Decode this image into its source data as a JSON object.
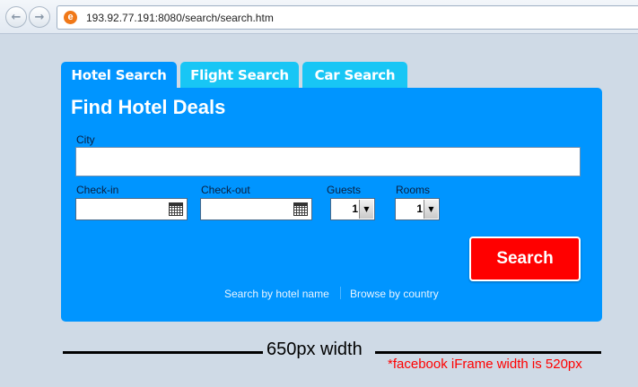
{
  "browser": {
    "url": "193.92.77.191:8080/search/search.htm",
    "site_icon": "e",
    "back_icon": "←",
    "forward_icon": "→"
  },
  "tabs": [
    {
      "label": "Hotel Search",
      "active": true
    },
    {
      "label": "Flight Search",
      "active": false
    },
    {
      "label": "Car Search",
      "active": false
    }
  ],
  "form": {
    "title": "Find Hotel Deals",
    "city_label": "City",
    "city_value": "",
    "checkin_label": "Check-in",
    "checkin_value": "",
    "checkout_label": "Check-out",
    "checkout_value": "",
    "guests_label": "Guests",
    "guests_value": "1",
    "rooms_label": "Rooms",
    "rooms_value": "1",
    "dropdown_arrow": "▼",
    "search_button": "Search",
    "link_hotel_name": "Search by hotel name",
    "link_country": "Browse by country"
  },
  "annotation": {
    "width_text": "650px width",
    "iframe_note": "*facebook iFrame width is 520px"
  },
  "colors": {
    "accent": "#0095ff",
    "inactive_tab": "#18c6f5",
    "search_button": "#ff0000",
    "page_background": "#cfdae6"
  },
  "icons": [
    "back-arrow-icon",
    "forward-arrow-icon",
    "site-favicon-icon",
    "calendar-icon",
    "chevron-down-icon"
  ]
}
